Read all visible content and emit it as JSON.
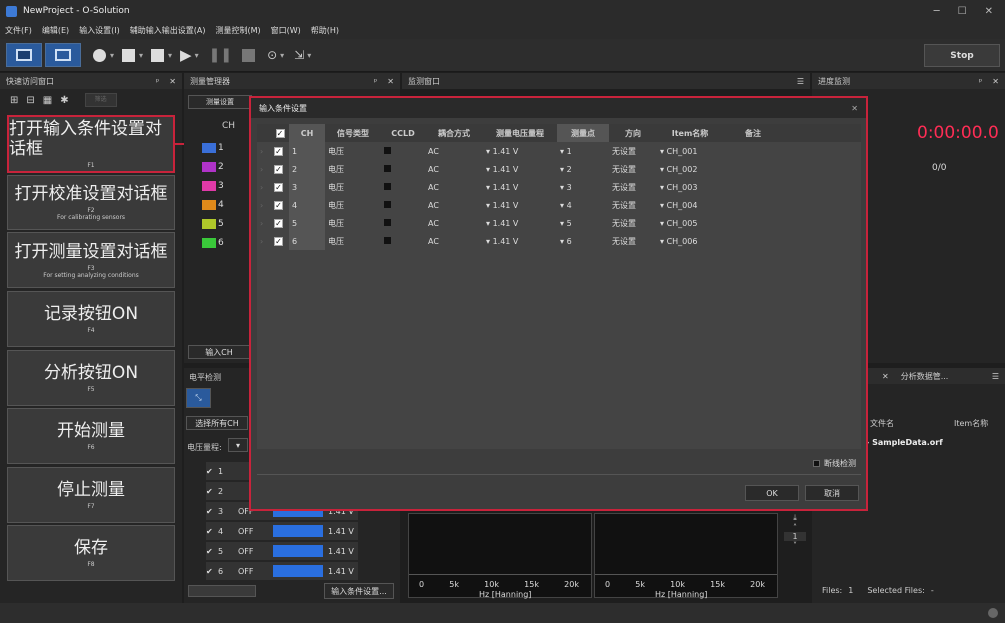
{
  "app": {
    "title": "NewProject - O-Solution"
  },
  "menu": [
    "文件(F)",
    "编辑(E)",
    "输入设置(I)",
    "辅助输入输出设置(A)",
    "测量控制(M)",
    "窗口(W)",
    "帮助(H)"
  ],
  "toolbar": {
    "stop_label": "Stop"
  },
  "quick_panel": {
    "title": "快速访问窗口",
    "pin": "ᵖ",
    "filter_label": "筛选",
    "buttons": [
      {
        "label": "打开输入条件设置对话框",
        "sub": "F1",
        "desc": ""
      },
      {
        "label": "打开校准设置对话框",
        "sub": "F2",
        "desc": "For calibrating sensors"
      },
      {
        "label": "打开测量设置对话框",
        "sub": "F3",
        "desc": "For setting analyzing conditions"
      },
      {
        "label": "记录按钮ON",
        "sub": "F4",
        "desc": ""
      },
      {
        "label": "分析按钮ON",
        "sub": "F5",
        "desc": ""
      },
      {
        "label": "开始测量",
        "sub": "F6",
        "desc": ""
      },
      {
        "label": "停止测量",
        "sub": "F7",
        "desc": ""
      },
      {
        "label": "保存",
        "sub": "F8",
        "desc": ""
      }
    ]
  },
  "measure_manager": {
    "title": "测量管理器",
    "tab_label": "测量设置",
    "ch_header": "CH",
    "rows": [
      "1",
      "2",
      "3",
      "4",
      "5",
      "6"
    ],
    "input_btn": "输入CH",
    "colors": [
      "#3a6fd8",
      "#b033c8",
      "#e03aa8",
      "#e08a1a",
      "#b0c82a",
      "#3ac83a"
    ]
  },
  "monitor": {
    "title": "监测窗口"
  },
  "progress": {
    "title": "进度监测",
    "time": "0:00:00.0",
    "count": "0/0"
  },
  "analysis": {
    "tab": "分析数据管...",
    "col_filename": "文件名",
    "col_item": "Item名称",
    "file": "SampleData.orf",
    "files_label": "Files:",
    "files_count": "1",
    "selected_label": "Selected Files:",
    "selected_value": "-"
  },
  "level_panel": {
    "title": "电平检测",
    "select_all": "选择所有CH",
    "range_label": "电压量程:",
    "rows": [
      {
        "ch": "1",
        "state": "",
        "value": ""
      },
      {
        "ch": "2",
        "state": "",
        "value": ""
      },
      {
        "ch": "3",
        "state": "OFF",
        "value": "1.41 V"
      },
      {
        "ch": "4",
        "state": "OFF",
        "value": "1.41 V"
      },
      {
        "ch": "5",
        "state": "OFF",
        "value": "1.41 V"
      },
      {
        "ch": "6",
        "state": "OFF",
        "value": "1.41 V"
      }
    ],
    "input_settings_btn": "输入条件设置..."
  },
  "charts": {
    "ticks": [
      "0",
      "5k",
      "10k",
      "15k",
      "20k"
    ],
    "xlabel_left": "Hz [Hanning]",
    "xlabel_right": "Hz [Hanning]",
    "right_control_value": "1"
  },
  "dialog": {
    "title": "输入条件设置",
    "headers": [
      "CH",
      "信号类型",
      "CCLD",
      "耦合方式",
      "测量电压量程",
      "测量点",
      "方向",
      "Item名称",
      "备注"
    ],
    "rows": [
      {
        "ch": "1",
        "signal": "电压",
        "coupling": "AC",
        "range": "1.41 V",
        "point": "1",
        "dir": "无设置",
        "item": "CH_001"
      },
      {
        "ch": "2",
        "signal": "电压",
        "coupling": "AC",
        "range": "1.41 V",
        "point": "2",
        "dir": "无设置",
        "item": "CH_002"
      },
      {
        "ch": "3",
        "signal": "电压",
        "coupling": "AC",
        "range": "1.41 V",
        "point": "3",
        "dir": "无设置",
        "item": "CH_003"
      },
      {
        "ch": "4",
        "signal": "电压",
        "coupling": "AC",
        "range": "1.41 V",
        "point": "4",
        "dir": "无设置",
        "item": "CH_004"
      },
      {
        "ch": "5",
        "signal": "电压",
        "coupling": "AC",
        "range": "1.41 V",
        "point": "5",
        "dir": "无设置",
        "item": "CH_005"
      },
      {
        "ch": "6",
        "signal": "电压",
        "coupling": "AC",
        "range": "1.41 V",
        "point": "6",
        "dir": "无设置",
        "item": "CH_006"
      }
    ],
    "break_detect": "断线检测",
    "ok": "OK",
    "cancel": "取消"
  }
}
